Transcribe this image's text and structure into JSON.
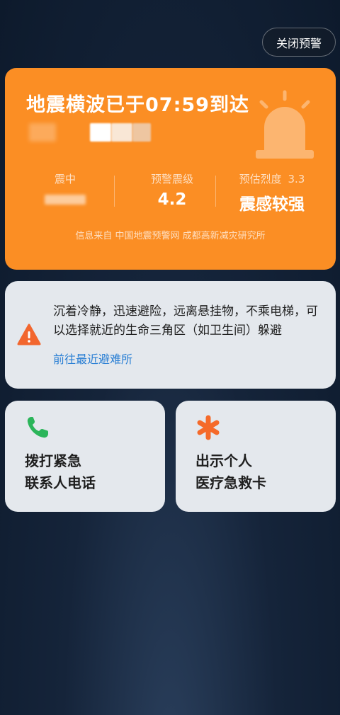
{
  "header": {
    "close_label": "关闭预警"
  },
  "alert": {
    "title": "地震横波已于07:59到达",
    "stats": {
      "epicenter": {
        "label": "震中"
      },
      "magnitude": {
        "label": "预警震级",
        "value": "4.2"
      },
      "intensity": {
        "label": "预估烈度",
        "level": "3.3",
        "value": "震感较强"
      }
    },
    "source": "信息来自 中国地震预警网 成都高新减灾研究所"
  },
  "advice": {
    "text": "沉着冷静，迅速避险，远离悬挂物，不乘电梯，可以选择就近的生命三角区（如卫生间）躲避",
    "link": "前往最近避难所"
  },
  "actions": {
    "call": {
      "label": "拨打紧急联系人电话",
      "line1": "拨打紧急",
      "line2": "联系人电话",
      "icon": "phone-icon"
    },
    "medical": {
      "label": "出示个人医疗急救卡",
      "line1": "出示个人",
      "line2": "医疗急救卡",
      "icon": "asterisk-icon"
    }
  },
  "colors": {
    "alert_bg": "#fb8e24",
    "card_bg": "#e4e8ed",
    "link": "#2a7fd4",
    "phone_green": "#2bb55a",
    "medical_orange": "#f56a2a",
    "warning_orange": "#f2662e"
  }
}
